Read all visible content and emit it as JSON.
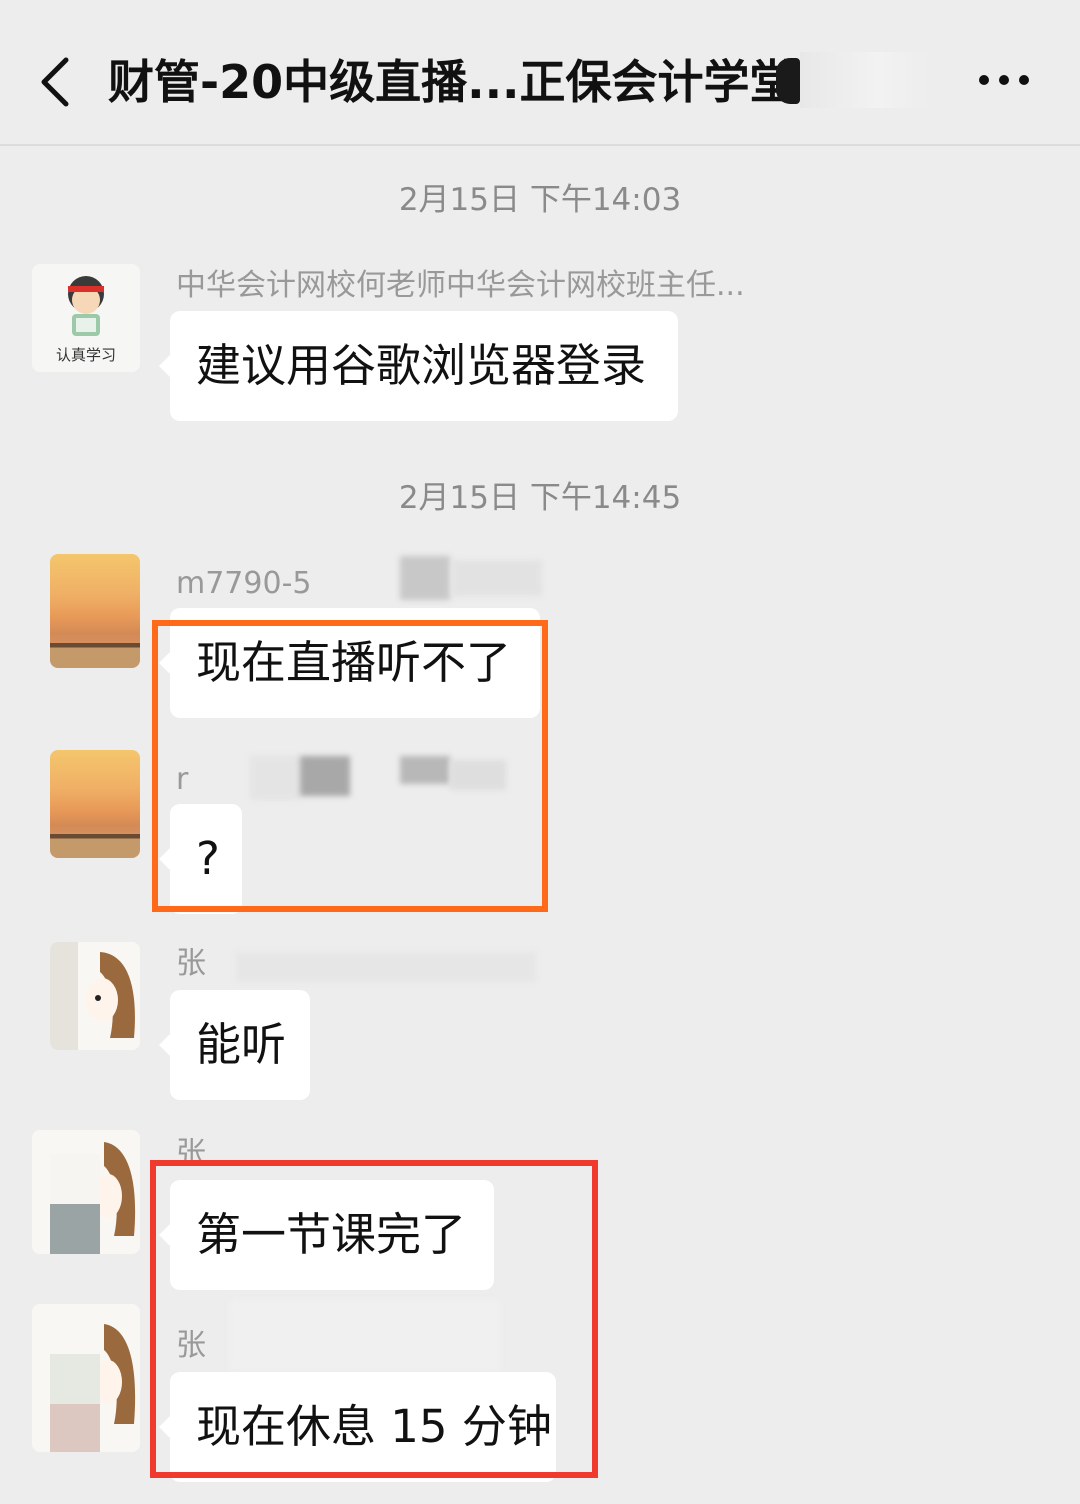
{
  "header": {
    "title": "财管-20中级直播...正保会计学堂",
    "back_icon": "chevron-left-icon",
    "more_icon": "more-horizontal-icon"
  },
  "timestamps": [
    "2月15日 下午14:03",
    "2月15日 下午14:45"
  ],
  "messages": [
    {
      "nickname": "中华会计网校何老师中华会计网校班主任...",
      "avatar_caption": "认真学习",
      "text": "建议用谷歌浏览器登录"
    },
    {
      "nickname": "m7790-5",
      "text": "现在直播听不了"
    },
    {
      "nickname": "r",
      "text": "?"
    },
    {
      "nickname": "张",
      "text": "能听"
    },
    {
      "nickname": "张",
      "text": "第一节课完了"
    },
    {
      "nickname": "张",
      "text": "现在休息 15 分钟"
    }
  ],
  "colors": {
    "background": "#ededed",
    "bubble": "#ffffff",
    "highlight_orange": "#ff6a1a",
    "highlight_red": "#f03a2e"
  }
}
